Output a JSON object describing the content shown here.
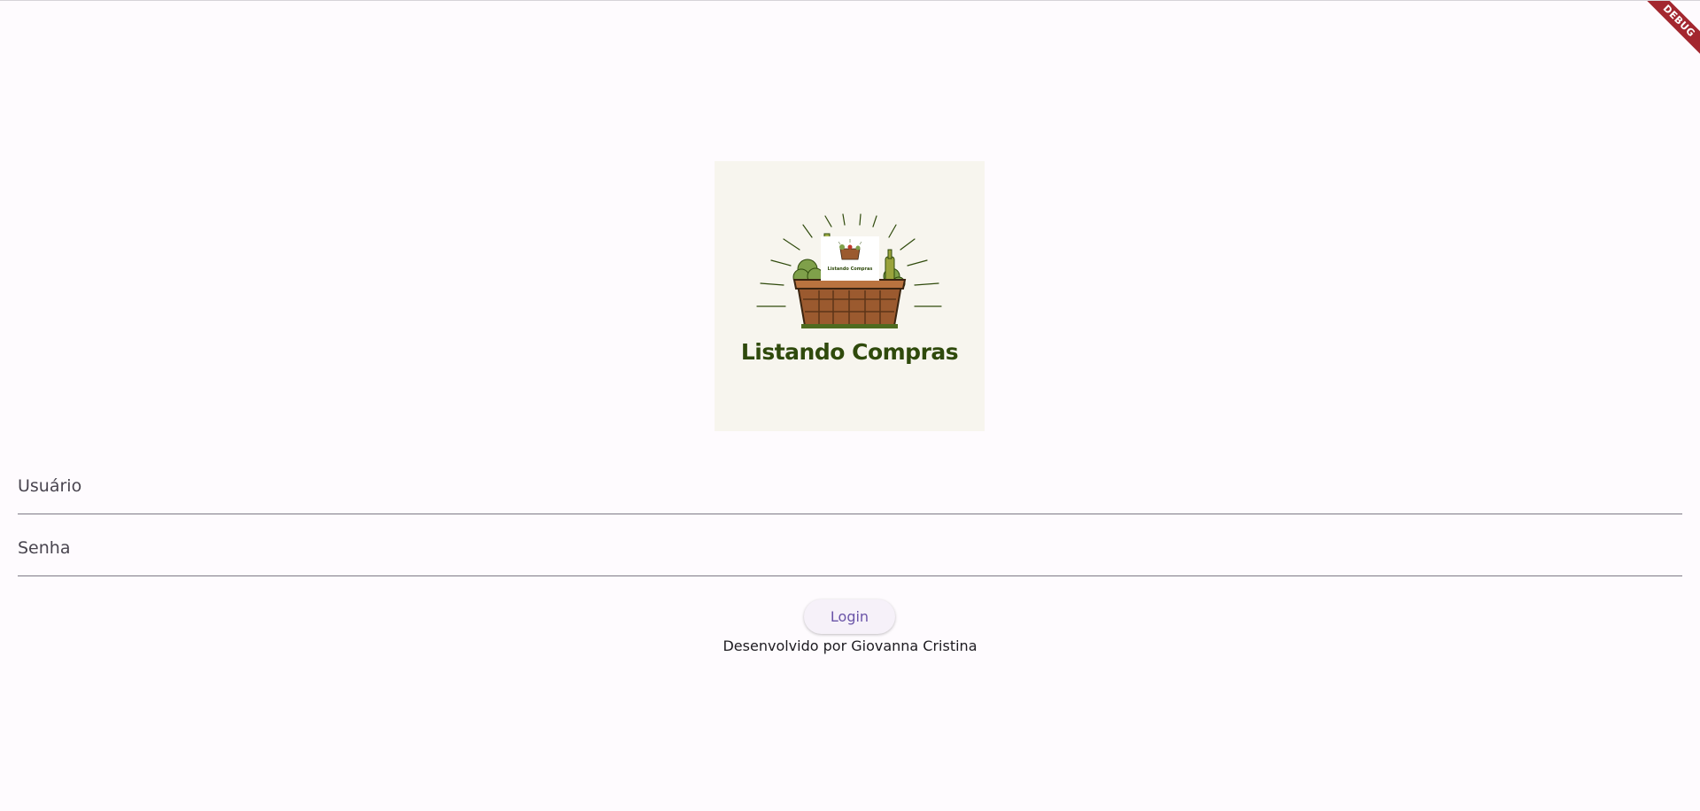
{
  "debug_banner": {
    "label": "DEBUG",
    "color": "#a3272f"
  },
  "logo": {
    "title": "Listando Compras",
    "mini_title": "Listando Compras",
    "title_color": "#2f4a0c",
    "background": "#f7f5ee"
  },
  "form": {
    "username_label": "Usuário",
    "password_label": "Senha",
    "login_label": "Login"
  },
  "footer": {
    "credit": "Desenvolvido por Giovanna Cristina"
  },
  "colors": {
    "background": "#fefbfe",
    "accent": "#6a54a8",
    "divider": "#7d7985"
  }
}
